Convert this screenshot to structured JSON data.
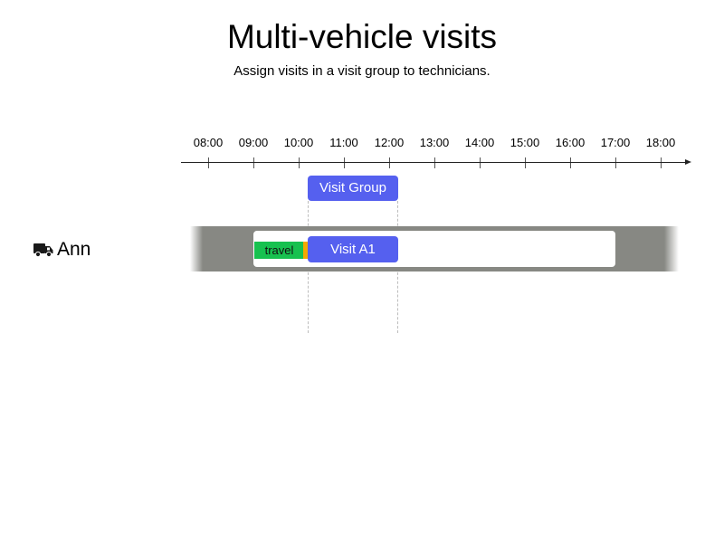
{
  "header": {
    "title": "Multi-vehicle visits",
    "subtitle": "Assign visits in a visit group to technicians."
  },
  "timeline": {
    "ticks": [
      "08:00",
      "09:00",
      "10:00",
      "11:00",
      "12:00",
      "13:00",
      "14:00",
      "15:00",
      "16:00",
      "17:00",
      "18:00"
    ]
  },
  "visit_group": {
    "label": "Visit Group",
    "start": "10:00",
    "end": "12:00",
    "color": "#5560ef"
  },
  "vehicles": [
    {
      "name": "Ann",
      "icon": "truck-icon",
      "shift_start": "09:00",
      "shift_end": "17:00",
      "travel": {
        "label": "travel",
        "start": "09:00",
        "end": "10:00",
        "color": "#17c14f"
      },
      "visit": {
        "label": "Visit A1",
        "start": "10:00",
        "end": "12:00",
        "color": "#5560ef"
      }
    }
  ]
}
